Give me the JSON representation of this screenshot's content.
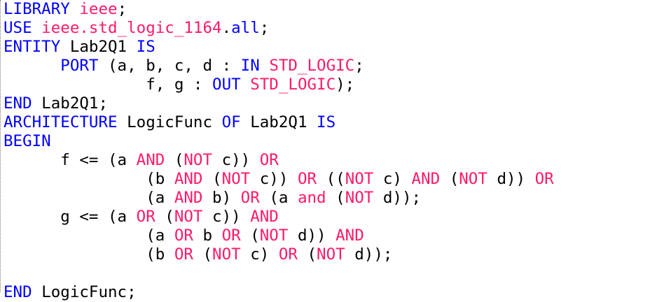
{
  "editor": {
    "language": "VHDL",
    "colors": {
      "keyword": "#0000ff",
      "operator_or_type": "#ff1a6a",
      "text": "#000000",
      "background": "#ffffff"
    },
    "lines": [
      {
        "indent": "",
        "tokens": [
          {
            "t": "LIBRARY ",
            "c": "kw"
          },
          {
            "t": "ieee",
            "c": "op"
          },
          {
            "t": ";",
            "c": "pl"
          }
        ]
      },
      {
        "indent": "",
        "tokens": [
          {
            "t": "USE ",
            "c": "kw"
          },
          {
            "t": "ieee.std_logic_1164",
            "c": "op"
          },
          {
            "t": ".",
            "c": "pl"
          },
          {
            "t": "all",
            "c": "kw"
          },
          {
            "t": ";",
            "c": "pl"
          }
        ]
      },
      {
        "indent": "",
        "tokens": [
          {
            "t": "ENTITY ",
            "c": "kw"
          },
          {
            "t": "Lab2Q1 ",
            "c": "pl"
          },
          {
            "t": "IS",
            "c": "kw"
          }
        ]
      },
      {
        "indent": "      ",
        "tokens": [
          {
            "t": "PORT ",
            "c": "kw"
          },
          {
            "t": "(a, b, c, d : ",
            "c": "pl"
          },
          {
            "t": "IN ",
            "c": "kw"
          },
          {
            "t": "STD_LOGIC",
            "c": "op"
          },
          {
            "t": ";",
            "c": "pl"
          }
        ]
      },
      {
        "indent": "               ",
        "tokens": [
          {
            "t": "f, g : ",
            "c": "pl"
          },
          {
            "t": "OUT ",
            "c": "kw"
          },
          {
            "t": "STD_LOGIC",
            "c": "op"
          },
          {
            "t": ");",
            "c": "pl"
          }
        ]
      },
      {
        "indent": "",
        "tokens": [
          {
            "t": "END ",
            "c": "kw"
          },
          {
            "t": "Lab2Q1;",
            "c": "pl"
          }
        ]
      },
      {
        "indent": "",
        "tokens": [
          {
            "t": "ARCHITECTURE ",
            "c": "kw"
          },
          {
            "t": "LogicFunc ",
            "c": "pl"
          },
          {
            "t": "OF ",
            "c": "kw"
          },
          {
            "t": "Lab2Q1 ",
            "c": "pl"
          },
          {
            "t": "IS",
            "c": "kw"
          }
        ]
      },
      {
        "indent": "",
        "tokens": [
          {
            "t": "BEGIN",
            "c": "kw"
          }
        ]
      },
      {
        "indent": "      ",
        "tokens": [
          {
            "t": "f <= (a ",
            "c": "pl"
          },
          {
            "t": "AND ",
            "c": "op"
          },
          {
            "t": "(",
            "c": "pl"
          },
          {
            "t": "NOT ",
            "c": "op"
          },
          {
            "t": "c)) ",
            "c": "pl"
          },
          {
            "t": "OR",
            "c": "op"
          }
        ]
      },
      {
        "indent": "               ",
        "tokens": [
          {
            "t": "(b ",
            "c": "pl"
          },
          {
            "t": "AND ",
            "c": "op"
          },
          {
            "t": "(",
            "c": "pl"
          },
          {
            "t": "NOT ",
            "c": "op"
          },
          {
            "t": "c)) ",
            "c": "pl"
          },
          {
            "t": "OR ",
            "c": "op"
          },
          {
            "t": "((",
            "c": "pl"
          },
          {
            "t": "NOT ",
            "c": "op"
          },
          {
            "t": "c) ",
            "c": "pl"
          },
          {
            "t": "AND ",
            "c": "op"
          },
          {
            "t": "(",
            "c": "pl"
          },
          {
            "t": "NOT ",
            "c": "op"
          },
          {
            "t": "d)) ",
            "c": "pl"
          },
          {
            "t": "OR",
            "c": "op"
          }
        ]
      },
      {
        "indent": "               ",
        "tokens": [
          {
            "t": "(a ",
            "c": "pl"
          },
          {
            "t": "AND ",
            "c": "op"
          },
          {
            "t": "b) ",
            "c": "pl"
          },
          {
            "t": "OR ",
            "c": "op"
          },
          {
            "t": "(a ",
            "c": "pl"
          },
          {
            "t": "and ",
            "c": "op"
          },
          {
            "t": "(",
            "c": "pl"
          },
          {
            "t": "NOT ",
            "c": "op"
          },
          {
            "t": "d));",
            "c": "pl"
          }
        ]
      },
      {
        "indent": "      ",
        "tokens": [
          {
            "t": "g <= (a ",
            "c": "pl"
          },
          {
            "t": "OR ",
            "c": "op"
          },
          {
            "t": "(",
            "c": "pl"
          },
          {
            "t": "NOT ",
            "c": "op"
          },
          {
            "t": "c)) ",
            "c": "pl"
          },
          {
            "t": "AND",
            "c": "op"
          }
        ]
      },
      {
        "indent": "               ",
        "tokens": [
          {
            "t": "(a ",
            "c": "pl"
          },
          {
            "t": "OR ",
            "c": "op"
          },
          {
            "t": "b ",
            "c": "pl"
          },
          {
            "t": "OR ",
            "c": "op"
          },
          {
            "t": "(",
            "c": "pl"
          },
          {
            "t": "NOT ",
            "c": "op"
          },
          {
            "t": "d)) ",
            "c": "pl"
          },
          {
            "t": "AND",
            "c": "op"
          }
        ]
      },
      {
        "indent": "               ",
        "tokens": [
          {
            "t": "(b ",
            "c": "pl"
          },
          {
            "t": "OR ",
            "c": "op"
          },
          {
            "t": "(",
            "c": "pl"
          },
          {
            "t": "NOT ",
            "c": "op"
          },
          {
            "t": "c) ",
            "c": "pl"
          },
          {
            "t": "OR ",
            "c": "op"
          },
          {
            "t": "(",
            "c": "pl"
          },
          {
            "t": "NOT ",
            "c": "op"
          },
          {
            "t": "d));",
            "c": "pl"
          }
        ]
      },
      {
        "indent": "",
        "tokens": []
      },
      {
        "indent": "",
        "tokens": [
          {
            "t": "END ",
            "c": "kw"
          },
          {
            "t": "LogicFunc;",
            "c": "pl"
          }
        ]
      }
    ]
  }
}
